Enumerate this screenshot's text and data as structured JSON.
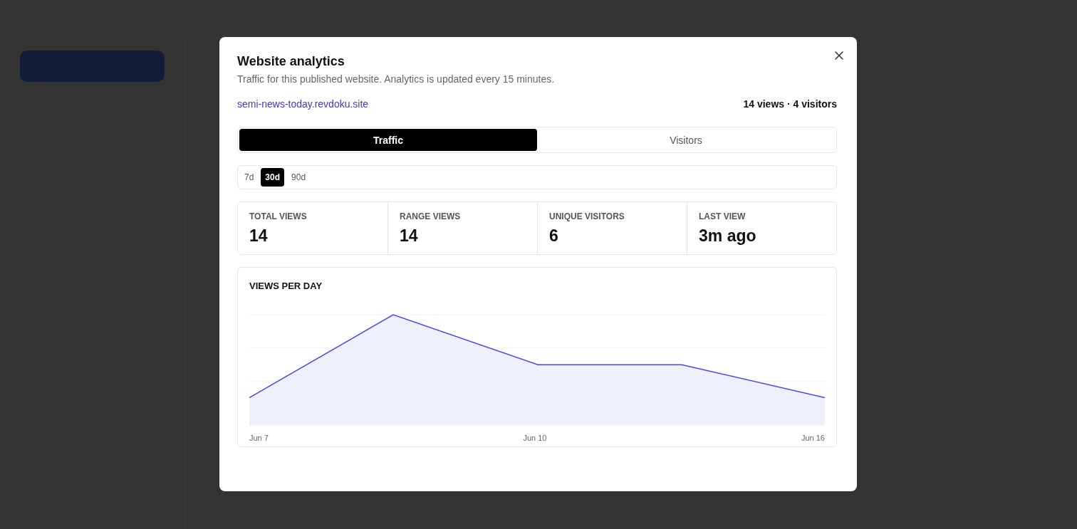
{
  "dialog": {
    "title": "Website analytics",
    "subtitle": "Traffic for this published website. Analytics is updated every 15 minutes.",
    "site_link": "semi-news-today.revdoku.site",
    "summary": "14 views · 4 visitors",
    "tabs": [
      {
        "label": "Traffic",
        "selected": true
      },
      {
        "label": "Visitors",
        "selected": false
      }
    ],
    "ranges": [
      {
        "label": "7d",
        "selected": false
      },
      {
        "label": "30d",
        "selected": true
      },
      {
        "label": "90d",
        "selected": false
      }
    ],
    "stats": [
      {
        "label": "TOTAL VIEWS",
        "value": "14"
      },
      {
        "label": "RANGE VIEWS",
        "value": "14"
      },
      {
        "label": "UNIQUE VISITORS",
        "value": "6"
      },
      {
        "label": "LAST VIEW",
        "value": "3m ago"
      }
    ],
    "chart": {
      "title": "VIEWS PER DAY",
      "x_labels": [
        "Jun 7",
        "Jun 10",
        "Jun 16"
      ]
    }
  }
}
